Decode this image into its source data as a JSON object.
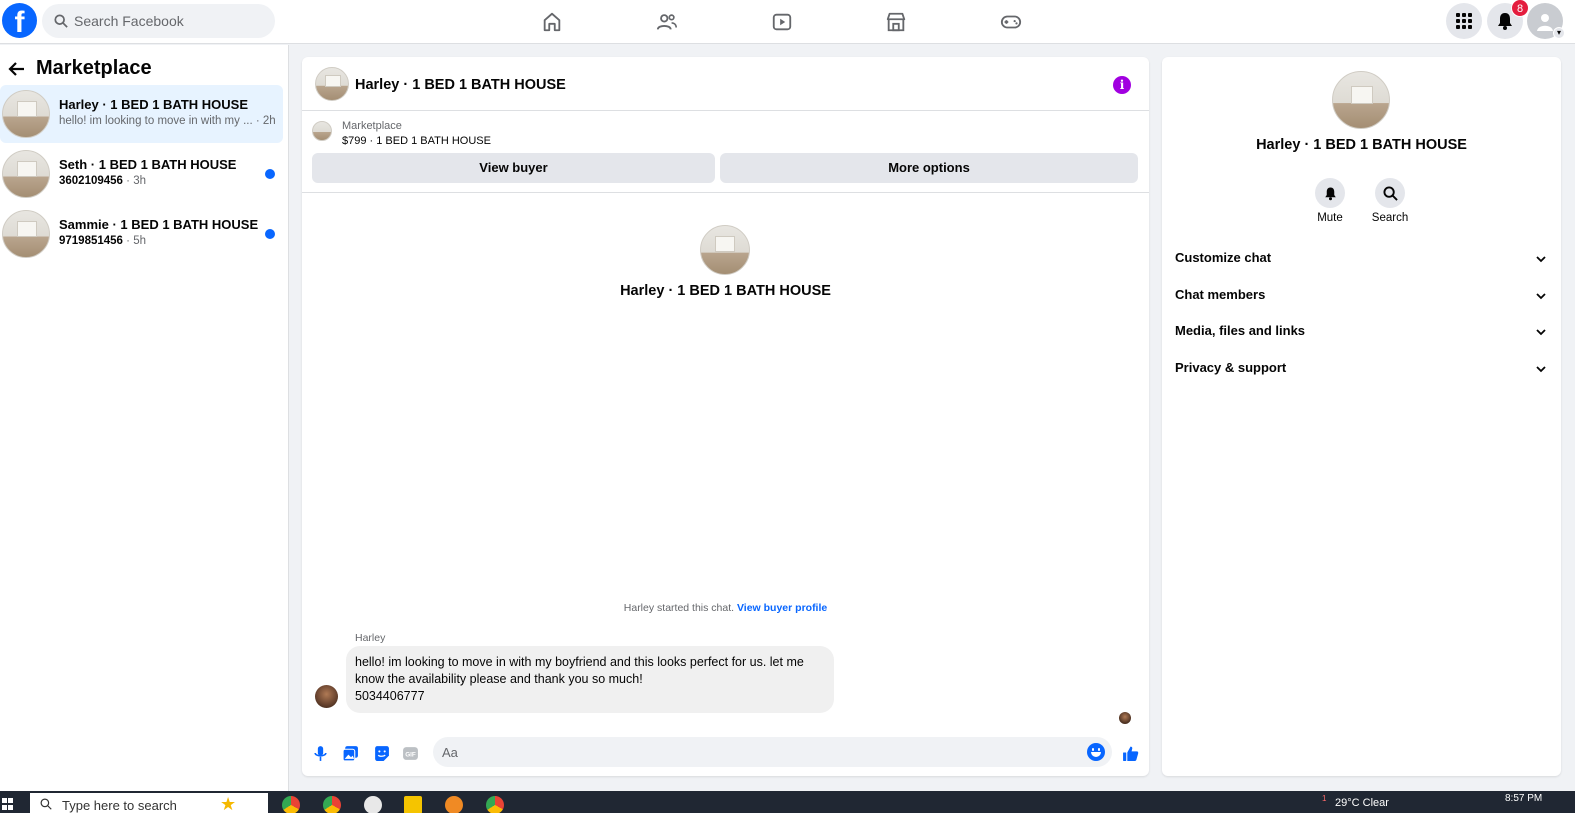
{
  "topbar": {
    "logo": "f",
    "search_placeholder": "Search Facebook",
    "nav_icons": [
      "home-icon",
      "friends-icon",
      "watch-icon",
      "marketplace-icon",
      "gaming-icon"
    ],
    "notification_count": "8"
  },
  "sidebar": {
    "title": "Marketplace",
    "conversations": [
      {
        "title": "Harley · 1 BED 1 BATH HOUSE",
        "preview": "hello! im looking to move in with my ...",
        "time": " · 2h",
        "unread": false,
        "active": true
      },
      {
        "title": "Seth · 1 BED 1 BATH HOUSE",
        "preview": "3602109456",
        "time": " · 3h",
        "unread": true,
        "active": false
      },
      {
        "title": "Sammie · 1 BED 1 BATH HOUSE",
        "preview": "9719851456",
        "time": " · 5h",
        "unread": true,
        "active": false
      }
    ]
  },
  "chat": {
    "header_name": "Harley · 1 BED 1 BATH HOUSE",
    "listing_label": "Marketplace",
    "listing_price": "$799 · 1 BED 1 BATH HOUSE",
    "view_buyer": "View buyer",
    "more_options": "More options",
    "intro_name": "Harley · 1 BED 1 BATH HOUSE",
    "started_text": "Harley started this chat. ",
    "started_link": "View buyer profile",
    "sender": "Harley",
    "message_lines": [
      "hello! im looking to move in with my boyfriend and this looks perfect for us. let me",
      "know the availability please and thank you so much!",
      "5034406777"
    ],
    "input_placeholder": "Aa"
  },
  "right_panel": {
    "name": "Harley · 1 BED 1 BATH HOUSE",
    "actions": {
      "mute": "Mute",
      "search": "Search"
    },
    "sections": [
      "Customize chat",
      "Chat members",
      "Media, files and links",
      "Privacy & support"
    ]
  },
  "taskbar": {
    "search_placeholder": "Type here to search",
    "weather": "29°C  Clear",
    "weather_badge": "1",
    "time": "8:57 PM"
  },
  "colors": {
    "brand": "#0866ff",
    "info": "#a100e0",
    "badge": "#e41e3f",
    "active_row": "#e7f3ff"
  }
}
